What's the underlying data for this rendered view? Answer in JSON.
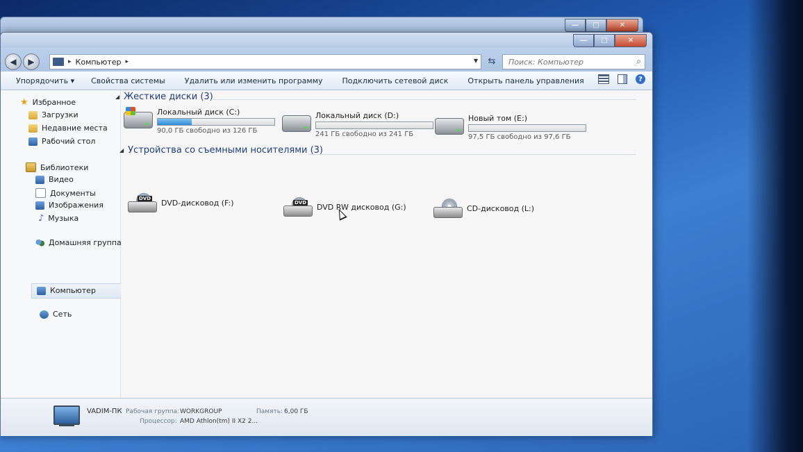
{
  "window": {
    "address": {
      "path": "Компьютер"
    },
    "search": {
      "placeholder": "Поиск: Компьютер"
    }
  },
  "toolbar": {
    "items": [
      "Упорядочить ▾",
      "Свойства системы",
      "Удалить или изменить программу",
      "Подключить сетевой диск",
      "Открыть панель управления"
    ]
  },
  "sidebar": {
    "favorites": {
      "label": "Избранное",
      "items": [
        "Загрузки",
        "Недавние места",
        "Рабочий стол"
      ]
    },
    "libraries": {
      "label": "Библиотеки",
      "items": [
        "Видео",
        "Документы",
        "Изображения",
        "Музыка"
      ]
    },
    "homegroup": "Домашняя группа",
    "computer": "Компьютер",
    "network": "Сеть"
  },
  "groups": {
    "hdd": {
      "header": "Жесткие диски (3)",
      "drives": [
        {
          "name": "Локальный диск (C:)",
          "free": "90,0 ГБ свободно из 126 ГБ",
          "used_fraction": 0.29
        },
        {
          "name": "Локальный диск (D:)",
          "free": "241 ГБ свободно из 241 ГБ",
          "used_fraction": 0.0
        },
        {
          "name": "Новый том (E:)",
          "free": "97,5 ГБ свободно из 97,6 ГБ",
          "used_fraction": 0.001
        }
      ]
    },
    "removable": {
      "header": "Устройства со съемными носителями (3)",
      "drives": [
        {
          "name": "DVD-дисковод (F:)",
          "badge": "DVD"
        },
        {
          "name": "DVD RW дисковод (G:)",
          "badge": "DVD"
        },
        {
          "name": "CD-дисковод (L:)"
        }
      ]
    }
  },
  "details": {
    "pc_name": "VADIM-ПК",
    "workgroup_label": "Рабочая группа:",
    "workgroup": "WORKGROUP",
    "memory_label": "Память:",
    "memory": "6,00 ГБ",
    "cpu_label": "Процессор:",
    "cpu": "AMD Athlon(tm) II X2 2..."
  }
}
